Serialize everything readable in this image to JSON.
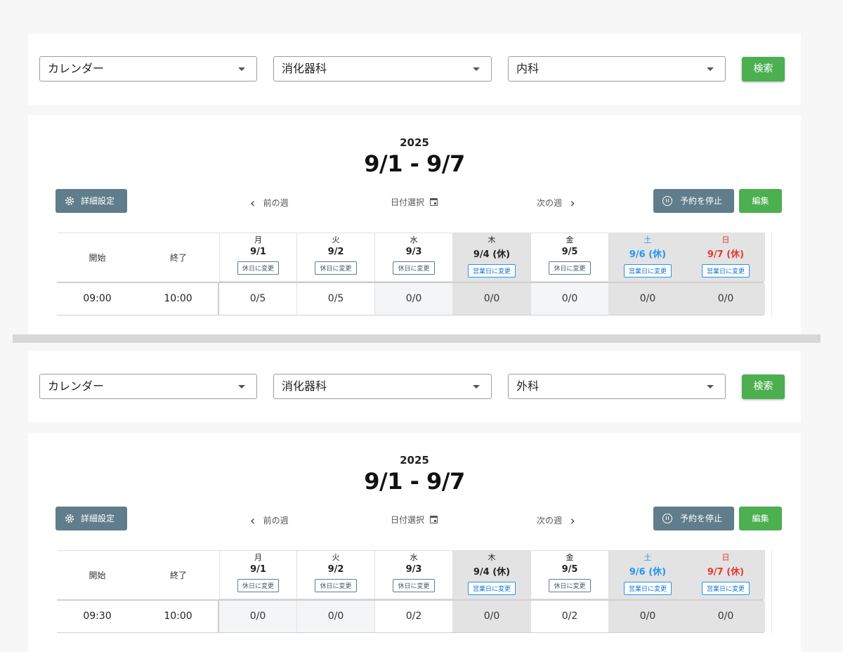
{
  "sections": [
    {
      "filters": {
        "calendar": "カレンダー",
        "department": "消化器科",
        "specialty": "内科",
        "search_label": "検索"
      },
      "calendar": {
        "year": "2025",
        "range": "9/1 - 9/7",
        "settings_label": "詳細設定",
        "prev_week": "前の週",
        "date_select": "日付選択",
        "next_week": "次の週",
        "stop_label": "予約を停止",
        "edit_label": "編集",
        "col_start": "開始",
        "col_end": "終了",
        "days": [
          {
            "dow": "月",
            "date": "9/1",
            "action": "休日に変更"
          },
          {
            "dow": "火",
            "date": "9/2",
            "action": "休日に変更"
          },
          {
            "dow": "水",
            "date": "9/3",
            "action": "休日に変更"
          },
          {
            "dow": "木",
            "date": "9/4 (休)",
            "action": "営業日に変更"
          },
          {
            "dow": "金",
            "date": "9/5",
            "action": "休日に変更"
          },
          {
            "dow": "土",
            "date": "9/6 (休)",
            "action": "営業日に変更"
          },
          {
            "dow": "日",
            "date": "9/7 (休)",
            "action": "営業日に変更"
          }
        ],
        "row": {
          "start": "09:00",
          "end": "10:00",
          "values": [
            "0/5",
            "0/5",
            "0/0",
            "0/0",
            "0/0",
            "0/0",
            "0/0"
          ]
        }
      }
    },
    {
      "filters": {
        "calendar": "カレンダー",
        "department": "消化器科",
        "specialty": "外科",
        "search_label": "検索"
      },
      "calendar": {
        "year": "2025",
        "range": "9/1 - 9/7",
        "settings_label": "詳細設定",
        "prev_week": "前の週",
        "date_select": "日付選択",
        "next_week": "次の週",
        "stop_label": "予約を停止",
        "edit_label": "編集",
        "col_start": "開始",
        "col_end": "終了",
        "days": [
          {
            "dow": "月",
            "date": "9/1",
            "action": "休日に変更"
          },
          {
            "dow": "火",
            "date": "9/2",
            "action": "休日に変更"
          },
          {
            "dow": "水",
            "date": "9/3",
            "action": "休日に変更"
          },
          {
            "dow": "木",
            "date": "9/4 (休)",
            "action": "営業日に変更"
          },
          {
            "dow": "金",
            "date": "9/5",
            "action": "休日に変更"
          },
          {
            "dow": "土",
            "date": "9/6 (休)",
            "action": "営業日に変更"
          },
          {
            "dow": "日",
            "date": "9/7 (休)",
            "action": "営業日に変更"
          }
        ],
        "row": {
          "start": "09:30",
          "end": "10:00",
          "values": [
            "0/0",
            "0/0",
            "0/2",
            "0/0",
            "0/2",
            "0/0",
            "0/0"
          ]
        }
      }
    }
  ],
  "colors": {
    "primary": "#4caf50",
    "secondary": "#607d8b",
    "saturday": "#2196f3",
    "sunday": "#e53935",
    "holiday_bg": "#e3e3e4"
  }
}
